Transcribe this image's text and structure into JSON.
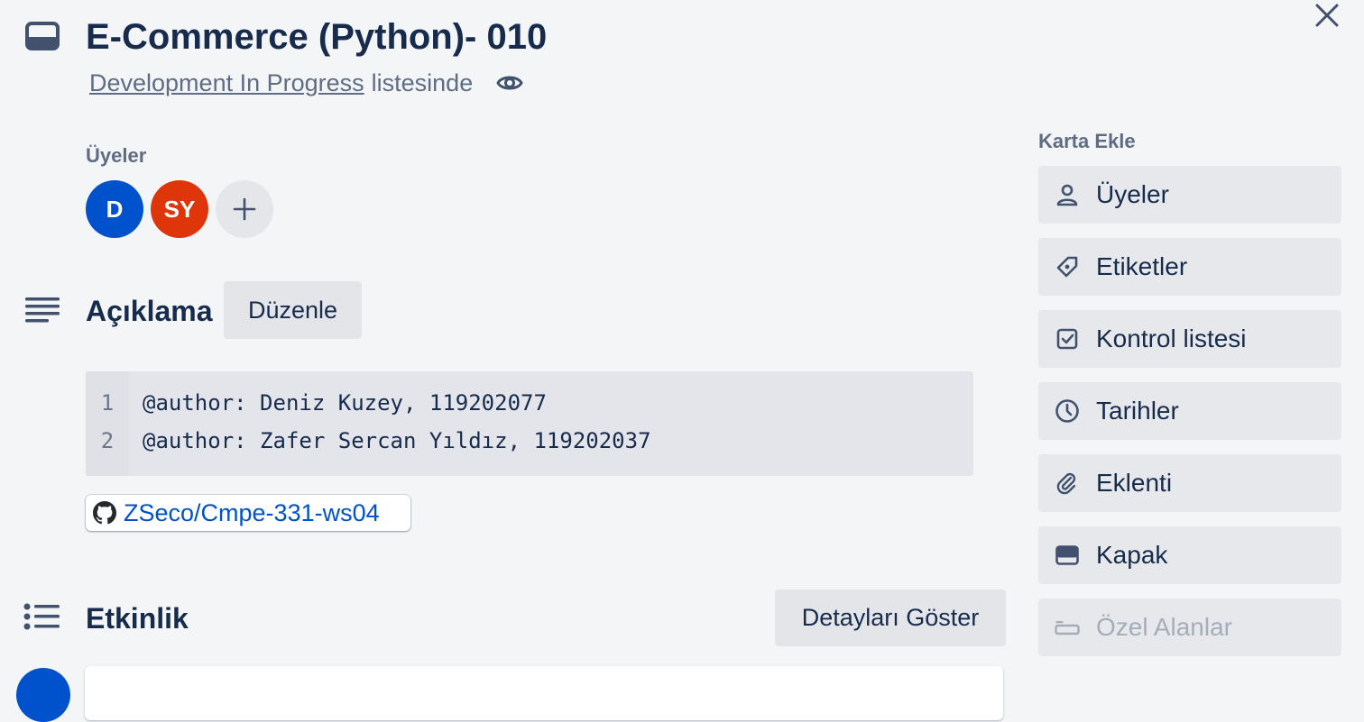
{
  "card": {
    "title": "E-Commerce (Python)- 010",
    "list_name": "Development In Progress",
    "list_suffix": "listesinde"
  },
  "members": {
    "label": "Üyeler",
    "avatars": [
      "D",
      "SY"
    ],
    "add_label": "+"
  },
  "description": {
    "heading": "Açıklama",
    "edit_label": "Düzenle",
    "code": {
      "line_numbers": [
        "1",
        "2"
      ],
      "lines": [
        "@author: Deniz Kuzey, 119202077",
        "@author: Zafer Sercan Yıldız, 119202037"
      ]
    },
    "github_link": "ZSeco/Cmpe-331-ws04"
  },
  "activity": {
    "heading": "Etkinlik",
    "details_label": "Detayları Göster"
  },
  "sidebar": {
    "heading": "Karta Ekle",
    "items": [
      {
        "label": "Üyeler",
        "icon": "person-icon"
      },
      {
        "label": "Etiketler",
        "icon": "tag-icon"
      },
      {
        "label": "Kontrol listesi",
        "icon": "checklist-icon"
      },
      {
        "label": "Tarihler",
        "icon": "clock-icon"
      },
      {
        "label": "Eklenti",
        "icon": "paperclip-icon"
      },
      {
        "label": "Kapak",
        "icon": "cover-icon"
      },
      {
        "label": "Özel Alanlar",
        "icon": "custom-fields-icon"
      }
    ]
  },
  "colors": {
    "background": "#f4f5f7",
    "text": "#172b4d",
    "link": "#0052cc",
    "avatar_d": "#0052cc",
    "avatar_sy": "#de350b"
  }
}
